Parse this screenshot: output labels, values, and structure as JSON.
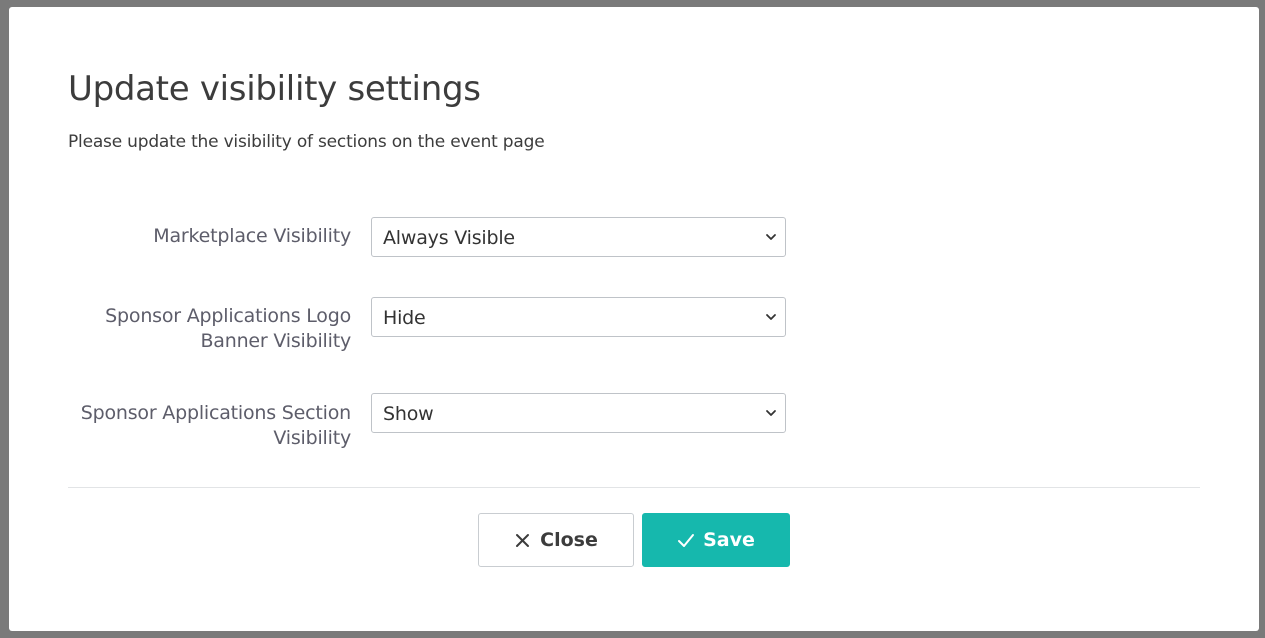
{
  "modal": {
    "title": "Update visibility settings",
    "subtitle": "Please update the visibility of sections on the event page"
  },
  "fields": [
    {
      "label": "Marketplace Visibility",
      "value": "Always Visible"
    },
    {
      "label": "Sponsor Applications Logo Banner Visibility",
      "value": "Hide"
    },
    {
      "label": "Sponsor Applications Section Visibility",
      "value": "Show"
    }
  ],
  "actions": {
    "close_label": "Close",
    "save_label": "Save"
  },
  "icons": {
    "close": "close-icon",
    "save": "check-icon",
    "select": "chevron-down-icon"
  },
  "colors": {
    "accent": "#16b8ad",
    "backdrop": "#7a7a7a"
  }
}
